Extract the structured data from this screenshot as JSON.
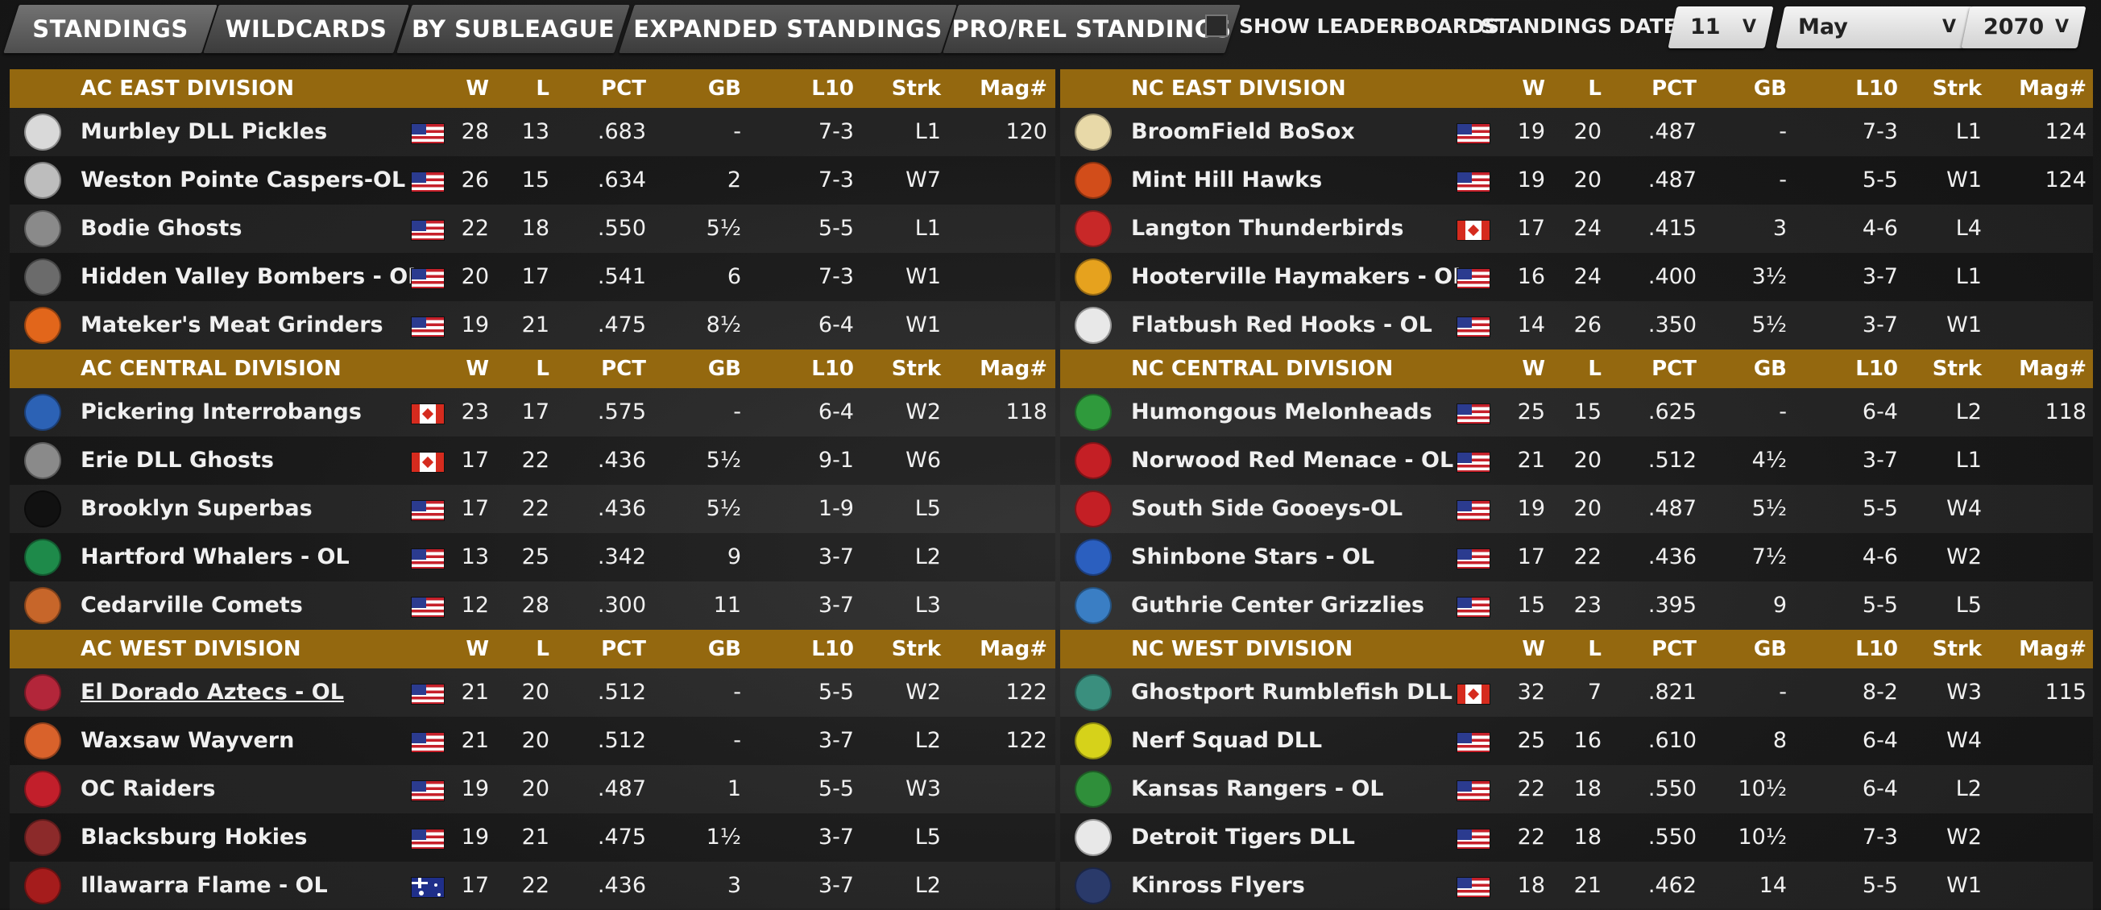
{
  "tabs": [
    {
      "label": "STANDINGS",
      "active": true
    },
    {
      "label": "WILDCARDS",
      "active": false
    },
    {
      "label": "BY SUBLEAGUE",
      "active": false
    },
    {
      "label": "EXPANDED STANDINGS",
      "active": false
    },
    {
      "label": "PRO/REL STANDINGS",
      "active": false
    }
  ],
  "controls": {
    "show_leaderboards_label": "SHOW LEADERBOARDS",
    "show_leaderboards_checked": false,
    "standings_date_label": "STANDINGS DATE:",
    "day": "11",
    "month": "May",
    "year": "2070",
    "dropdown_arrow": "V"
  },
  "columns": [
    "W",
    "L",
    "PCT",
    "GB",
    "L10",
    "Strk",
    "Mag#"
  ],
  "divisions": {
    "ac_east": {
      "name": "AC EAST DIVISION",
      "teams": [
        {
          "name": "Murbley DLL Pickles",
          "flag": "us",
          "w": "28",
          "l": "13",
          "pct": ".683",
          "gb": "-",
          "l10": "7-3",
          "strk": "L1",
          "mag": "120",
          "logo": "pickle-logo-icon",
          "color": "#d9d9d9"
        },
        {
          "name": "Weston Pointe Caspers-OL",
          "flag": "us",
          "w": "26",
          "l": "15",
          "pct": ".634",
          "gb": "2",
          "l10": "7-3",
          "strk": "W7",
          "mag": "",
          "logo": "ghost-logo-icon",
          "color": "#bdbdbd"
        },
        {
          "name": "Bodie Ghosts",
          "flag": "us",
          "w": "22",
          "l": "18",
          "pct": ".550",
          "gb": "5½",
          "l10": "5-5",
          "strk": "L1",
          "mag": "",
          "logo": "ghosts-script-logo-icon",
          "color": "#8a8a8a"
        },
        {
          "name": "Hidden Valley Bombers - OL",
          "flag": "us",
          "w": "20",
          "l": "17",
          "pct": ".541",
          "gb": "6",
          "l10": "7-3",
          "strk": "W1",
          "mag": "",
          "logo": "bomber-logo-icon",
          "color": "#6b6b6b"
        },
        {
          "name": "Mateker's Meat Grinders",
          "flag": "us",
          "w": "19",
          "l": "21",
          "pct": ".475",
          "gb": "8½",
          "l10": "6-4",
          "strk": "W1",
          "mag": "",
          "logo": "mg-logo-icon",
          "color": "#e2661b"
        }
      ]
    },
    "ac_central": {
      "name": "AC CENTRAL DIVISION",
      "teams": [
        {
          "name": "Pickering Interrobangs",
          "flag": "ca",
          "w": "23",
          "l": "17",
          "pct": ".575",
          "gb": "-",
          "l10": "6-4",
          "strk": "W2",
          "mag": "118",
          "logo": "interrobang-logo-icon",
          "color": "#2c62b5"
        },
        {
          "name": "Erie DLL Ghosts",
          "flag": "ca",
          "w": "17",
          "l": "22",
          "pct": ".436",
          "gb": "5½",
          "l10": "9-1",
          "strk": "W6",
          "mag": "",
          "logo": "ghosts-script-logo-icon",
          "color": "#8a8a8a"
        },
        {
          "name": "Brooklyn Superbas",
          "flag": "us",
          "w": "17",
          "l": "22",
          "pct": ".436",
          "gb": "5½",
          "l10": "1-9",
          "strk": "L5",
          "mag": "",
          "logo": "b-logo-icon",
          "color": "#111111"
        },
        {
          "name": "Hartford Whalers - OL",
          "flag": "us",
          "w": "13",
          "l": "25",
          "pct": ".342",
          "gb": "9",
          "l10": "3-7",
          "strk": "L2",
          "mag": "",
          "logo": "whale-logo-icon",
          "color": "#1e8a4a"
        },
        {
          "name": "Cedarville Comets",
          "flag": "us",
          "w": "12",
          "l": "28",
          "pct": ".300",
          "gb": "11",
          "l10": "3-7",
          "strk": "L3",
          "mag": "",
          "logo": "comet-logo-icon",
          "color": "#c7662a"
        }
      ]
    },
    "ac_west": {
      "name": "AC WEST DIVISION",
      "teams": [
        {
          "name": "El Dorado Aztecs - OL",
          "flag": "us",
          "w": "21",
          "l": "20",
          "pct": ".512",
          "gb": "-",
          "l10": "5-5",
          "strk": "W2",
          "mag": "122",
          "logo": "aztec-logo-icon",
          "color": "#b3263a",
          "underline": true
        },
        {
          "name": "Waxsaw Wayvern",
          "flag": "us",
          "w": "21",
          "l": "20",
          "pct": ".512",
          "gb": "-",
          "l10": "3-7",
          "strk": "L2",
          "mag": "122",
          "logo": "wyvern-logo-icon",
          "color": "#d9622b"
        },
        {
          "name": "OC Raiders",
          "flag": "us",
          "w": "19",
          "l": "20",
          "pct": ".487",
          "gb": "1",
          "l10": "5-5",
          "strk": "W3",
          "mag": "",
          "logo": "r-logo-icon",
          "color": "#c21f2b"
        },
        {
          "name": "Blacksburg Hokies",
          "flag": "us",
          "w": "19",
          "l": "21",
          "pct": ".475",
          "gb": "1½",
          "l10": "3-7",
          "strk": "L5",
          "mag": "",
          "logo": "hokies-logo-icon",
          "color": "#8c2a2a"
        },
        {
          "name": "Illawarra Flame - OL",
          "flag": "au",
          "w": "17",
          "l": "22",
          "pct": ".436",
          "gb": "3",
          "l10": "3-7",
          "strk": "L2",
          "mag": "",
          "logo": "flame-logo-icon",
          "color": "#a51c1c"
        }
      ]
    },
    "nc_east": {
      "name": "NC EAST DIVISION",
      "teams": [
        {
          "name": "BroomField BoSox",
          "flag": "us",
          "w": "19",
          "l": "20",
          "pct": ".487",
          "gb": "-",
          "l10": "7-3",
          "strk": "L1",
          "mag": "124",
          "logo": "b-diamond-logo-icon",
          "color": "#e8d9a8"
        },
        {
          "name": "Mint Hill Hawks",
          "flag": "us",
          "w": "19",
          "l": "20",
          "pct": ".487",
          "gb": "-",
          "l10": "5-5",
          "strk": "W1",
          "mag": "124",
          "logo": "hawk-logo-icon",
          "color": "#d24d1a"
        },
        {
          "name": "Langton Thunderbirds",
          "flag": "ca",
          "w": "17",
          "l": "24",
          "pct": ".415",
          "gb": "3",
          "l10": "4-6",
          "strk": "L4",
          "mag": "",
          "logo": "thunderbird-logo-icon",
          "color": "#c82828"
        },
        {
          "name": "Hooterville Haymakers - OL",
          "flag": "us",
          "w": "16",
          "l": "24",
          "pct": ".400",
          "gb": "3½",
          "l10": "3-7",
          "strk": "L1",
          "mag": "",
          "logo": "h-logo-icon",
          "color": "#e6a21e"
        },
        {
          "name": "Flatbush Red Hooks - OL",
          "flag": "us",
          "w": "14",
          "l": "26",
          "pct": ".350",
          "gb": "5½",
          "l10": "3-7",
          "strk": "W1",
          "mag": "",
          "logo": "no-money-logo-icon",
          "color": "#e8e8e8"
        }
      ]
    },
    "nc_central": {
      "name": "NC CENTRAL DIVISION",
      "teams": [
        {
          "name": "Humongous Melonheads",
          "flag": "us",
          "w": "25",
          "l": "15",
          "pct": ".625",
          "gb": "-",
          "l10": "6-4",
          "strk": "L2",
          "mag": "118",
          "logo": "melonhead-logo-icon",
          "color": "#2f9a3c"
        },
        {
          "name": "Norwood Red Menace - OL",
          "flag": "us",
          "w": "21",
          "l": "20",
          "pct": ".512",
          "gb": "4½",
          "l10": "3-7",
          "strk": "L1",
          "mag": "",
          "logo": "n-logo-icon",
          "color": "#c41f25"
        },
        {
          "name": "South Side Gooeys-OL",
          "flag": "us",
          "w": "19",
          "l": "20",
          "pct": ".487",
          "gb": "5½",
          "l10": "5-5",
          "strk": "W4",
          "mag": "",
          "logo": "stl-logo-icon",
          "color": "#c41f25"
        },
        {
          "name": "Shinbone Stars - OL",
          "flag": "us",
          "w": "17",
          "l": "22",
          "pct": ".436",
          "gb": "7½",
          "l10": "4-6",
          "strk": "W2",
          "mag": "",
          "logo": "stars-logo-icon",
          "color": "#2b5fbf"
        },
        {
          "name": "Guthrie Center Grizzlies",
          "flag": "us",
          "w": "15",
          "l": "23",
          "pct": ".395",
          "gb": "9",
          "l10": "5-5",
          "strk": "L5",
          "mag": "",
          "logo": "grizzlies-logo-icon",
          "color": "#3a7ec4"
        }
      ]
    },
    "nc_west": {
      "name": "NC WEST DIVISION",
      "teams": [
        {
          "name": "Ghostport Rumblefish DLL",
          "flag": "ca",
          "w": "32",
          "l": "7",
          "pct": ".821",
          "gb": "-",
          "l10": "8-2",
          "strk": "W3",
          "mag": "115",
          "logo": "fish-logo-icon",
          "color": "#3a8f7e"
        },
        {
          "name": "Nerf Squad DLL",
          "flag": "us",
          "w": "25",
          "l": "16",
          "pct": ".610",
          "gb": "8",
          "l10": "6-4",
          "strk": "W4",
          "mag": "",
          "logo": "nerf-logo-icon",
          "color": "#d6d21a"
        },
        {
          "name": "Kansas Rangers - OL",
          "flag": "us",
          "w": "22",
          "l": "18",
          "pct": ".550",
          "gb": "10½",
          "l10": "6-4",
          "strk": "L2",
          "mag": "",
          "logo": "kr-logo-icon",
          "color": "#2f8f3a"
        },
        {
          "name": "Detroit Tigers DLL",
          "flag": "us",
          "w": "22",
          "l": "18",
          "pct": ".550",
          "gb": "10½",
          "l10": "7-3",
          "strk": "W2",
          "mag": "",
          "logo": "d-logo-icon",
          "color": "#e8e8e8"
        },
        {
          "name": "Kinross Flyers",
          "flag": "us",
          "w": "18",
          "l": "21",
          "pct": ".462",
          "gb": "14",
          "l10": "5-5",
          "strk": "W1",
          "mag": "",
          "logo": "flyers-logo-icon",
          "color": "#2a3a6a"
        }
      ]
    }
  }
}
